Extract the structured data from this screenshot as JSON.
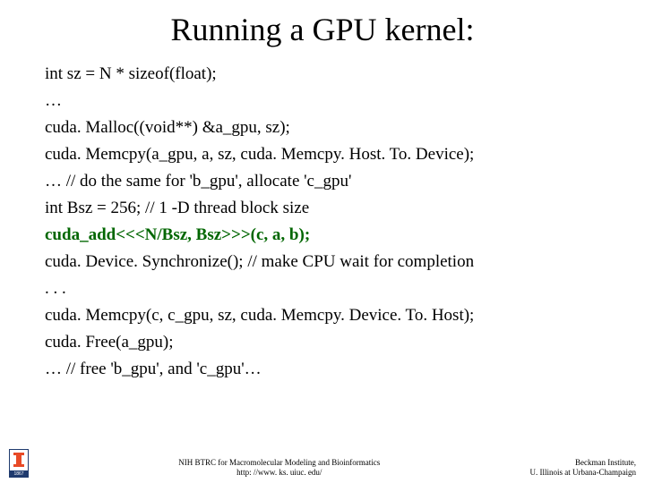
{
  "title": "Running a GPU kernel:",
  "code": {
    "l1": "int sz = N * sizeof(float);",
    "l2": "…",
    "l3": "cuda. Malloc((void**) &a_gpu, sz);",
    "l4": "cuda. Memcpy(a_gpu, a, sz, cuda. Memcpy. Host. To. Device);",
    "l5": "… // do the same for 'b_gpu', allocate 'c_gpu'",
    "l6": "int Bsz = 256; // 1 -D thread block size",
    "l7": "cuda_add<<<N/Bsz, Bsz>>>(c, a, b);",
    "l8": "cuda. Device. Synchronize(); // make CPU wait for completion",
    "l9": ". . .",
    "l10": "cuda. Memcpy(c, c_gpu, sz, cuda. Memcpy. Device. To. Host);",
    "l11": "cuda. Free(a_gpu);",
    "l12": "… // free 'b_gpu', and 'c_gpu'…"
  },
  "footer": {
    "logo_year": "1867",
    "center_line1": "NIH BTRC for Macromolecular Modeling and Bioinformatics",
    "center_line2": "http: //www. ks. uiuc. edu/",
    "right_line1": "Beckman Institute,",
    "right_line2": "U. Illinois at Urbana-Champaign"
  }
}
